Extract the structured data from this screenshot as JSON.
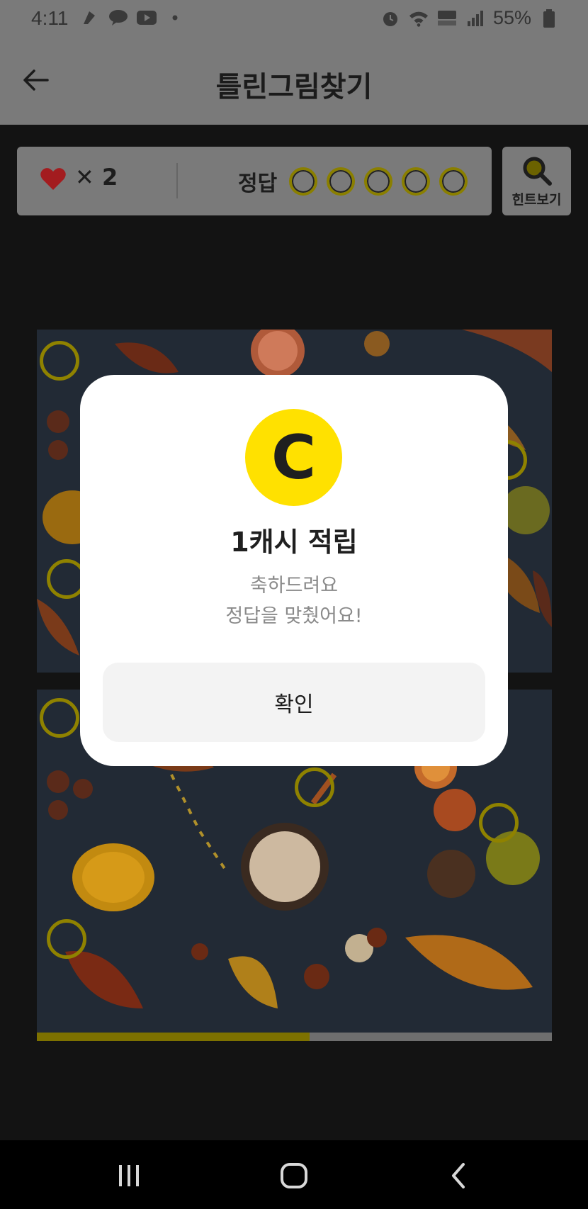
{
  "status_bar": {
    "time": "4:11",
    "battery": "55%",
    "battery_level": "7",
    "icons": [
      "notification-icon",
      "kakaotalk-icon",
      "youtube-icon",
      "dot-icon",
      "alarm-icon",
      "wifi-icon",
      "hd-voice-icon",
      "signal-icon",
      "battery-icon"
    ]
  },
  "header": {
    "title": "틀린그림찾기",
    "back_icon": "arrow-left-icon"
  },
  "game_info": {
    "lives_prefix": "✕",
    "lives": "2",
    "answer_label": "정답",
    "answer_slots_total": 5,
    "answer_slots_found": 0,
    "heart_color": "#a31c1f"
  },
  "hint": {
    "label": "힌트보기",
    "icon": "magnifier-icon"
  },
  "progress": {
    "fraction": 0.53,
    "fill_color": "#7d7100"
  },
  "modal": {
    "icon_letter": "C",
    "title": "1캐시 적립",
    "message_line1": "축하드려요",
    "message_line2": "정답을 맞췄어요!",
    "confirm_label": "확인",
    "icon_color": "#ffe100"
  },
  "nav": {
    "recent_icon": "recent-apps-icon",
    "home_icon": "home-icon",
    "back_icon": "back-chevron-icon"
  }
}
